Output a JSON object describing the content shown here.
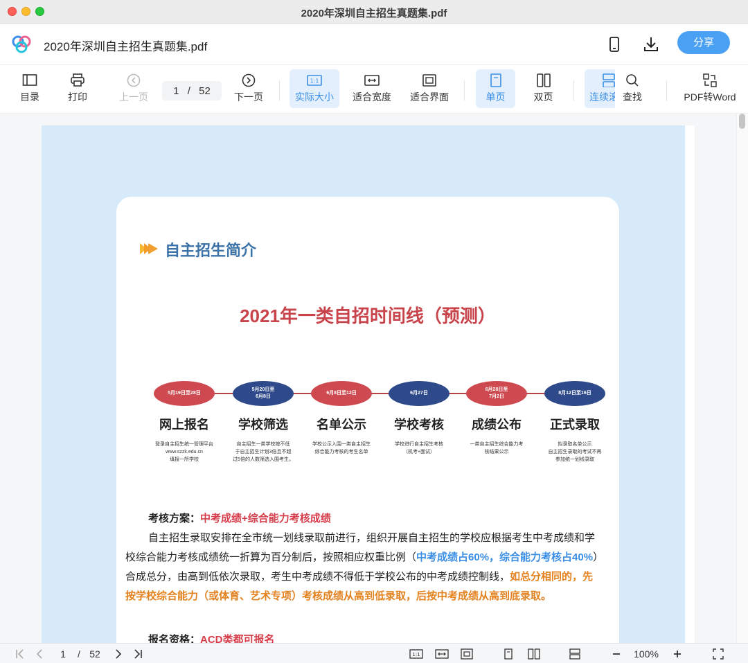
{
  "window": {
    "title": "2020年深圳自主招生真题集.pdf"
  },
  "header": {
    "doc_name": "2020年深圳自主招生真题集.pdf",
    "share_label": "分享"
  },
  "toolbar": {
    "toc": "目录",
    "print": "打印",
    "prev": "上一页",
    "page_current": "1",
    "page_sep": "/",
    "page_total": "52",
    "next": "下一页",
    "actual_size": "实际大小",
    "fit_width": "适合宽度",
    "fit_page": "适合界面",
    "single": "单页",
    "double": "双页",
    "continuous": "连续滚",
    "find": "查找",
    "pdf_to_word": "PDF转Word"
  },
  "document": {
    "section_title": "自主招生简介",
    "main_title": "2021年一类自招时间线（预测）",
    "steps": [
      {
        "date": "5月19日至28日",
        "title": "网上报名",
        "desc": "登录自主招生统一管理平台\nwww.szzk.edu.cn\n填报一所学校"
      },
      {
        "date": "5月20日至\n6月8日",
        "title": "学校筛选",
        "desc": "自主招生一类学校按不低\n于自主招生计划3倍且不超\n过5倍的人数筛选入围考生。"
      },
      {
        "date": "6月8日至12日",
        "title": "名单公示",
        "desc": "学校公示入围一类自主招生\n综合能力考核的考生名单"
      },
      {
        "date": "6月27日",
        "title": "学校考核",
        "desc": "学校进行自主招生考核\n（机考+面试）"
      },
      {
        "date": "6月28日至\n7月2日",
        "title": "成绩公布",
        "desc": "一类自主招生综合能力考\n核结果公示"
      },
      {
        "date": "8月12日至16日",
        "title": "正式录取",
        "desc": "拟录取名单公示\n自主招生录取的考试不再\n参加统一划线录取"
      }
    ],
    "assess_label": "考核方案：",
    "assess_value": "中考成绩+综合能力考核成绩",
    "p1_a": "自主招生录取安排在全市统一划线录取前进行，组织开展自主招生的学校应根据考生中考成绩和学校综合能力考核成绩统一折算为百分制后，按照相应权重比例（",
    "p1_blue": "中考成绩占60%，综合能力考核占40%",
    "p1_b": "）合成总分，由高到低依次录取，考生中考成绩不得低于学校公布的中考成绩控制线，",
    "p1_orange": "如总分相同的，先按学校综合能力（或体育、艺术专项）考核成绩从高到低录取，后按中考成绩从高到底录取。",
    "qual_label": "报名资格：",
    "qual_value": "ACD类都可报名"
  },
  "bottombar": {
    "page_current": "1",
    "page_sep": "/",
    "page_total": "52",
    "zoom": "100%"
  },
  "colors": {
    "accent": "#4aa0f3",
    "active_bg": "#e3effc",
    "page_bg": "#d6eafa",
    "title_red": "#c9434b"
  }
}
